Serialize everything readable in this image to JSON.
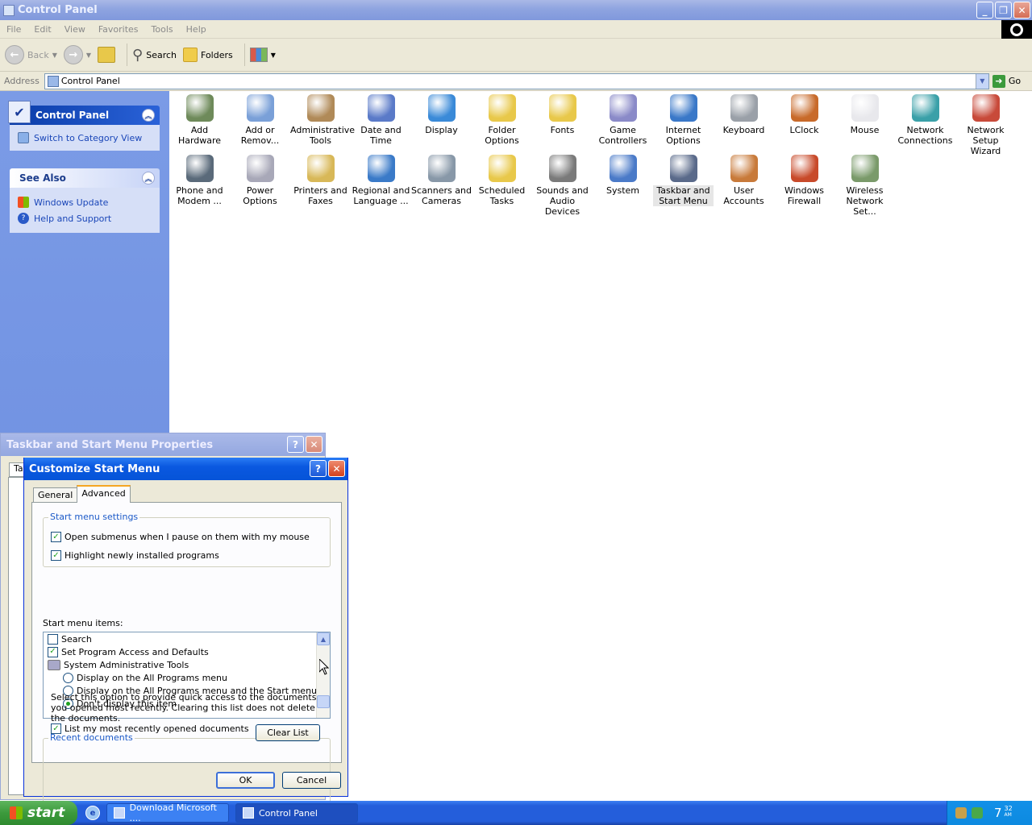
{
  "window": {
    "title": "Control Panel"
  },
  "menu": [
    "File",
    "Edit",
    "View",
    "Favorites",
    "Tools",
    "Help"
  ],
  "toolbar": {
    "back": "Back",
    "search": "Search",
    "folders": "Folders"
  },
  "address": {
    "label": "Address",
    "value": "Control Panel",
    "go": "Go"
  },
  "taskpane": {
    "main_title": "Control Panel",
    "switch_link": "Switch to Category View",
    "see_also_title": "See Also",
    "links": [
      "Windows Update",
      "Help and Support"
    ]
  },
  "icons": [
    {
      "label": "Add Hardware",
      "color": "#6e8a5a"
    },
    {
      "label": "Add or\nRemov...",
      "color": "#7aa0d8"
    },
    {
      "label": "Administrative\nTools",
      "color": "#b08a58"
    },
    {
      "label": "Date and Time",
      "color": "#5a7ac8"
    },
    {
      "label": "Display",
      "color": "#3a8ad8"
    },
    {
      "label": "Folder Options",
      "color": "#e8c84a"
    },
    {
      "label": "Fonts",
      "color": "#e8c84a"
    },
    {
      "label": "Game\nControllers",
      "color": "#8a8ac8"
    },
    {
      "label": "Internet\nOptions",
      "color": "#3a78c8"
    },
    {
      "label": "Keyboard",
      "color": "#9aa0a8"
    },
    {
      "label": "LClock",
      "color": "#c86a2a"
    },
    {
      "label": "Mouse",
      "color": "#e8e8ec"
    },
    {
      "label": "Network\nConnections",
      "color": "#3aa0a8"
    },
    {
      "label": "Network Setup\nWizard",
      "color": "#c84a3a"
    },
    {
      "label": "Phone and\nModem ...",
      "color": "#5a6a7a"
    },
    {
      "label": "Power Options",
      "color": "#a8a8b8"
    },
    {
      "label": "Printers and\nFaxes",
      "color": "#d8b858"
    },
    {
      "label": "Regional and\nLanguage ...",
      "color": "#3a7ac8"
    },
    {
      "label": "Scanners and\nCameras",
      "color": "#8898a8"
    },
    {
      "label": "Scheduled\nTasks",
      "color": "#e8c84a"
    },
    {
      "label": "Sounds and\nAudio Devices",
      "color": "#7a7a7a"
    },
    {
      "label": "System",
      "color": "#4a7ac8"
    },
    {
      "label": "Taskbar and\nStart Menu",
      "color": "#5a6a8a"
    },
    {
      "label": "User Accounts",
      "color": "#c87a3a"
    },
    {
      "label": "Windows\nFirewall",
      "color": "#c84a2a"
    },
    {
      "label": "Wireless\nNetwork Set...",
      "color": "#7a9a6a"
    }
  ],
  "back_dialog": {
    "title": "Taskbar and Start Menu Properties",
    "tab_fragment": "Ta"
  },
  "dialog": {
    "title": "Customize Start Menu",
    "tabs": [
      "General",
      "Advanced"
    ],
    "settings_group": "Start menu settings",
    "settings": [
      {
        "label": "Open submenus when I pause on them with my mouse",
        "checked": true
      },
      {
        "label": "Highlight newly installed programs",
        "checked": true
      }
    ],
    "items_label": "Start menu items:",
    "items": {
      "search": "Search",
      "set_program": "Set Program Access and Defaults",
      "admin_tools": "System Administrative Tools",
      "opt1": "Display on the All Programs menu",
      "opt2": "Display on the All Programs menu and the Start menu",
      "opt3": "Don't display this item"
    },
    "recent_group": "Recent documents",
    "recent_desc": "Select this option to provide quick access to the documents you opened most recently.  Clearing this list does not delete the documents.",
    "recent_check": "List my most recently opened documents",
    "clear_list": "Clear List",
    "ok": "OK",
    "cancel": "Cancel"
  },
  "taskbar": {
    "start": "start",
    "tasks": [
      "Download Microsoft ....",
      "Control Panel"
    ],
    "clock_main": "7",
    "clock_min": "32",
    "clock_ampm": "AM"
  }
}
